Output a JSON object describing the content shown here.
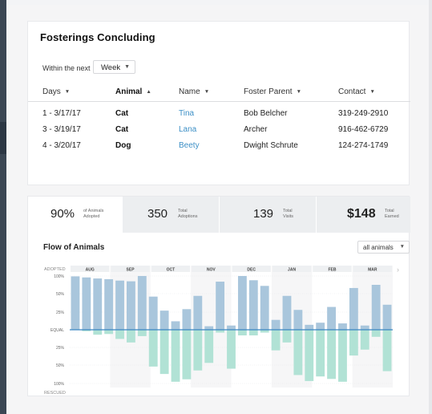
{
  "fosterings": {
    "title": "Fosterings Concluding",
    "within_label": "Within the next",
    "period_select": "Week",
    "columns": [
      {
        "label": "Days",
        "sort": "down",
        "bold": false
      },
      {
        "label": "Animal",
        "sort": "up",
        "bold": true
      },
      {
        "label": "Name",
        "sort": "down",
        "bold": false
      },
      {
        "label": "Foster Parent",
        "sort": "down",
        "bold": false
      },
      {
        "label": "Contact",
        "sort": "down",
        "bold": false
      }
    ],
    "rows": [
      {
        "days": "1 - 3/17/17",
        "animal": "Cat",
        "name": "Tina",
        "foster_parent": "Bob Belcher",
        "contact": "319-249-2910"
      },
      {
        "days": "3 - 3/19/17",
        "animal": "Cat",
        "name": "Lana",
        "foster_parent": "Archer",
        "contact": "916-462-6729"
      },
      {
        "days": "4 - 3/20/17",
        "animal": "Dog",
        "name": "Beety",
        "foster_parent": "Dwight Schrute",
        "contact": "124-274-1749"
      }
    ]
  },
  "stats": [
    {
      "value": "90%",
      "label": "of Animals Adopted",
      "bold": false
    },
    {
      "value": "350",
      "label": "Total Adoptions",
      "bold": false
    },
    {
      "value": "139",
      "label": "Total Visits",
      "bold": false
    },
    {
      "value": "$148",
      "label": "Total Earned",
      "bold": true
    }
  ],
  "flow": {
    "title": "Flow of Animals",
    "filter_select": "all animals",
    "next_arrow": "›"
  },
  "colors": {
    "adopted": "#a9c6dc",
    "rescued": "#b1e2d5",
    "equal_line": "#3a86c2",
    "link": "#3c8fc6"
  },
  "chart_data": {
    "type": "bar",
    "title": "Flow of Animals",
    "top_label": "ADOPTED",
    "bottom_label": "RESCUED",
    "months": [
      "AUG",
      "SEP",
      "OCT",
      "NOV",
      "DEC",
      "JAN",
      "FEB",
      "MAR"
    ],
    "y_ticks": [
      "100%",
      "50%",
      "25%",
      "EQUAL",
      "25%",
      "50%",
      "100%"
    ],
    "series": [
      {
        "name": "ADOPTED",
        "values": [
          99,
          96,
          93,
          91,
          87,
          85,
          100,
          46,
          27,
          12,
          29,
          47,
          5,
          84,
          6,
          100,
          88,
          72,
          14,
          47,
          28,
          7,
          10,
          32,
          9,
          66,
          6,
          75,
          35
        ]
      },
      {
        "name": "RESCUED",
        "values": [
          0,
          -2,
          -7,
          -6,
          -13,
          -18,
          -9,
          -52,
          -73,
          -95,
          -88,
          -63,
          -46,
          -4,
          -58,
          -8,
          -8,
          -4,
          -29,
          -18,
          -76,
          -93,
          -80,
          -87,
          -95,
          -36,
          -28,
          -10,
          -65
        ]
      }
    ]
  }
}
